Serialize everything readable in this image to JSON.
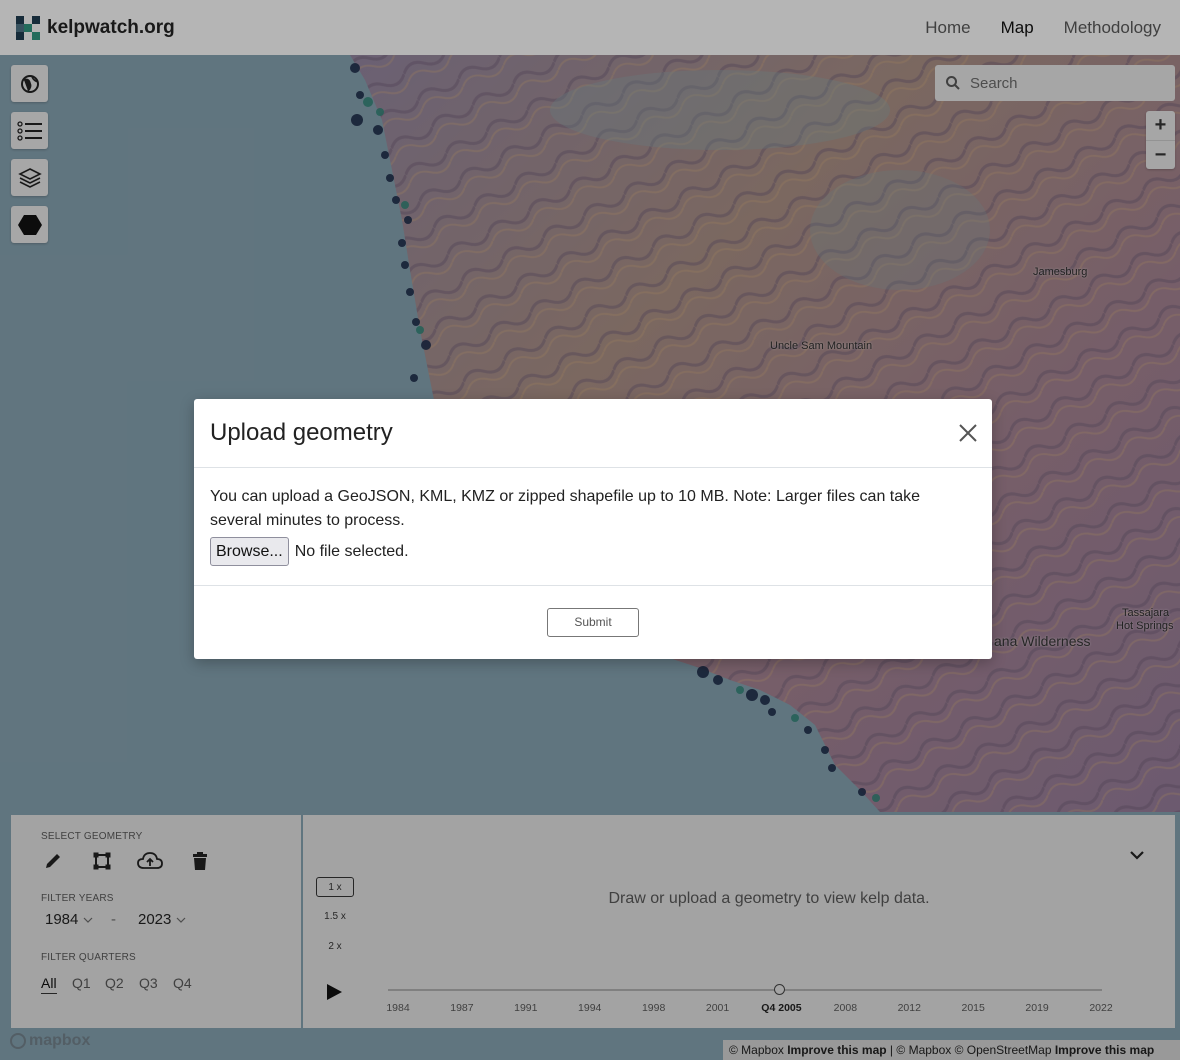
{
  "brand": {
    "name": "kelpwatch.org"
  },
  "nav": {
    "links": [
      "Home",
      "Map",
      "Methodology"
    ],
    "active": "Map"
  },
  "search": {
    "placeholder": "Search"
  },
  "zoom": {
    "in": "+",
    "out": "−"
  },
  "tools": [
    "globe-icon",
    "legend-list-icon",
    "layers-icon",
    "hexagon-icon"
  ],
  "map_labels": {
    "jamesburg": "Jamesburg",
    "uncle_sam": "Uncle Sam Mountain",
    "wilderness": "ana Wilderness",
    "tassajara_1": "Tassajara",
    "tassajara_2": "Hot Springs"
  },
  "modal": {
    "title": "Upload geometry",
    "description": "You can upload a GeoJSON, KML, KMZ or zipped shapefile up to 10 MB. Note: Larger files can take several minutes to process.",
    "browse_label": "Browse...",
    "file_status": "No file selected.",
    "submit_label": "Submit"
  },
  "panel": {
    "select_geometry_label": "SELECT GEOMETRY",
    "geometry_tools": [
      "pencil-icon",
      "polygon-icon",
      "cloud-upload-icon",
      "trash-icon"
    ],
    "filter_years_label": "FILTER YEARS",
    "year_start": "1984",
    "year_separator": "-",
    "year_end": "2023",
    "filter_quarters_label": "FILTER QUARTERS",
    "quarters": [
      "All",
      "Q1",
      "Q2",
      "Q3",
      "Q4"
    ],
    "active_quarter": "All",
    "speeds": [
      "1 x",
      "1.5 x",
      "2 x"
    ],
    "active_speed": "1 x",
    "empty_message": "Draw or upload a geometry to view kelp data.",
    "timeline_ticks": [
      "1984",
      "1987",
      "1991",
      "1994",
      "1998",
      "2001",
      "Q4 2005",
      "2008",
      "2012",
      "2015",
      "2019",
      "2022"
    ],
    "current_tick": "Q4 2005",
    "timeline_position": 0.548
  },
  "attribution": {
    "mapbox_logo": "mapbox",
    "parts": [
      "© Mapbox",
      "Improve this map",
      "|",
      "© Mapbox",
      "© OpenStreetMap",
      "Improve this map"
    ]
  },
  "colors": {
    "ocean": "#7f9aa7",
    "navbar": "#eeeeee",
    "panel": "#d6d6d6",
    "logo_dark": "#1f3a4d",
    "logo_teal": "#2f8f7a"
  }
}
